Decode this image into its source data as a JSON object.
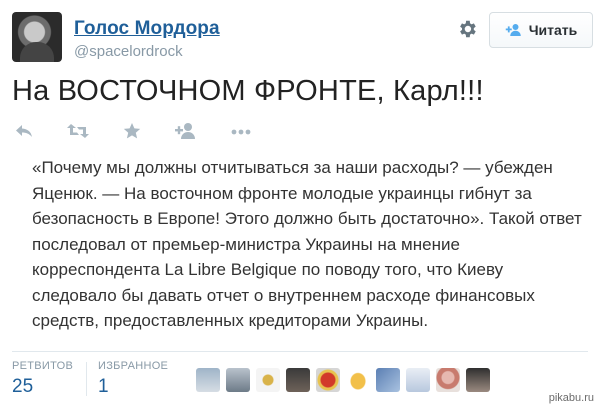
{
  "account": {
    "name": "Голос Мордора",
    "handle": "@spacelordrock"
  },
  "header": {
    "follow_label": "Читать",
    "settings_icon": "gear-icon"
  },
  "tweet": {
    "text": "На ВОСТОЧНОМ ФРОНТЕ, Карл!!!"
  },
  "actions": {
    "icons": [
      "reply-icon",
      "retweet-icon",
      "favorite-icon",
      "follow-icon",
      "more-icon"
    ]
  },
  "quote": {
    "text": "«Почему мы должны отчитываться за наши расходы? — убежден Яценюк. — На восточном фронте молодые украинцы гибнут за безопасность в Европе! Этого должно быть достаточно». Такой ответ последовал от премьер-министра Украины на мнение корреспондента La Libre Belgique по поводу того, что Киеву следовало бы давать отчет о внутреннем расходе финансовых средств, предоставленных кредиторами Украины."
  },
  "stats": {
    "retweets_label": "РЕТВИТОВ",
    "retweets_value": "25",
    "favorites_label": "ИЗБРАННОЕ",
    "favorites_value": "1"
  },
  "colors": {
    "name_link": "#1f5f99",
    "muted": "#8899a6",
    "text": "#292f33"
  },
  "watermark": "pikabu.ru"
}
